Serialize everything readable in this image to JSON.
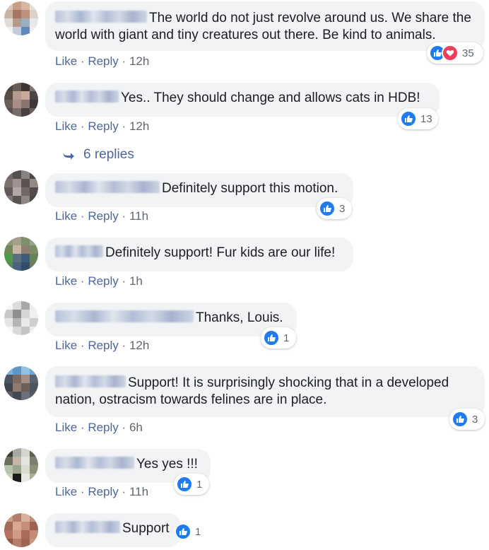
{
  "comments": [
    {
      "text": "The world do not just revolve around us. We share the world with giant and tiny creatures out there. Be kind to animals.",
      "like": "Like",
      "reply": "Reply",
      "time": "12h",
      "reactions": [
        "like-icon",
        "love-icon"
      ],
      "reaction_count": "35"
    },
    {
      "text": "Yes.. They should change and allows cats in HDB!",
      "like": "Like",
      "reply": "Reply",
      "time": "12h",
      "reactions": [
        "like-icon"
      ],
      "reaction_count": "13"
    },
    {
      "text": "Definitely support this motion.",
      "like": "Like",
      "reply": "Reply",
      "time": "11h",
      "reactions": [
        "like-icon"
      ],
      "reaction_count": "3"
    },
    {
      "text": "Definitely support! Fur kids are our life!",
      "like": "Like",
      "reply": "Reply",
      "time": "1h"
    },
    {
      "text": "Thanks, Louis.",
      "like": "Like",
      "reply": "Reply",
      "time": "12h",
      "reactions": [
        "like-icon"
      ],
      "reaction_count": "1"
    },
    {
      "text": "Support! It is surprisingly shocking that in a developed nation, ostracism towards felines are in place.",
      "like": "Like",
      "reply": "Reply",
      "time": "6h",
      "reactions": [
        "like-icon"
      ],
      "reaction_count": "3"
    },
    {
      "text": "Yes yes !!!",
      "like": "Like",
      "reply": "Reply",
      "time": "11h",
      "reactions": [
        "like-icon"
      ],
      "reaction_count": "1"
    },
    {
      "text": "Support",
      "reactions": [
        "like-icon"
      ],
      "reaction_count": "1"
    }
  ],
  "replies_link": "6 replies",
  "separator": "·",
  "colors": {
    "link": "#4b67a1",
    "meta": "#606770",
    "bubble": "#f2f3f5",
    "like": "#1f7bf2",
    "love": "#ef3e5c"
  }
}
